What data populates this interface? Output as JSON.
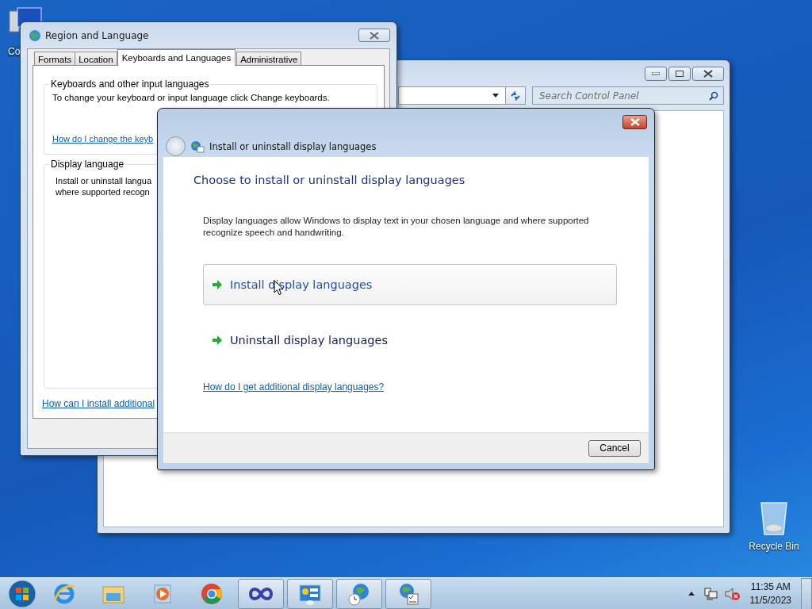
{
  "desktop": {
    "icons": [
      {
        "label": "Co"
      },
      {
        "label": "Recycle Bin"
      }
    ]
  },
  "control_panel_window": {
    "search": {
      "placeholder": "Search Control Panel"
    }
  },
  "region_window": {
    "title": "Region and Language",
    "tabs": [
      {
        "label": "Formats",
        "selected": false
      },
      {
        "label": "Location",
        "selected": false
      },
      {
        "label": "Keyboards and Languages",
        "selected": true
      },
      {
        "label": "Administrative",
        "selected": false
      }
    ],
    "keyboards_group": {
      "title": "Keyboards and other input languages",
      "text": "To change your keyboard or input language click Change keyboards.",
      "link": "How do I change the keyb"
    },
    "display_group": {
      "title": "Display language",
      "lines": [
        "Install or uninstall langua",
        "where supported recogn"
      ]
    },
    "link": "How can I install additional"
  },
  "dialog": {
    "title": "Install or uninstall display languages",
    "heading": "Choose to install or uninstall display languages",
    "description": "Display languages allow Windows to display text in your chosen language and where supported recognize speech and handwriting.",
    "options": [
      {
        "label": "Install display languages",
        "highlighted": true
      },
      {
        "label": "Uninstall display languages",
        "highlighted": false
      }
    ],
    "help_link": "How do I get additional display languages?",
    "cancel": "Cancel"
  },
  "taskbar": {
    "buttons": [
      {
        "running": false
      },
      {
        "running": false
      },
      {
        "running": false
      },
      {
        "running": false
      },
      {
        "running": true
      },
      {
        "running": true
      },
      {
        "running": true
      },
      {
        "running": true
      }
    ],
    "time": "11:35 AM",
    "date": "11/5/2023"
  }
}
